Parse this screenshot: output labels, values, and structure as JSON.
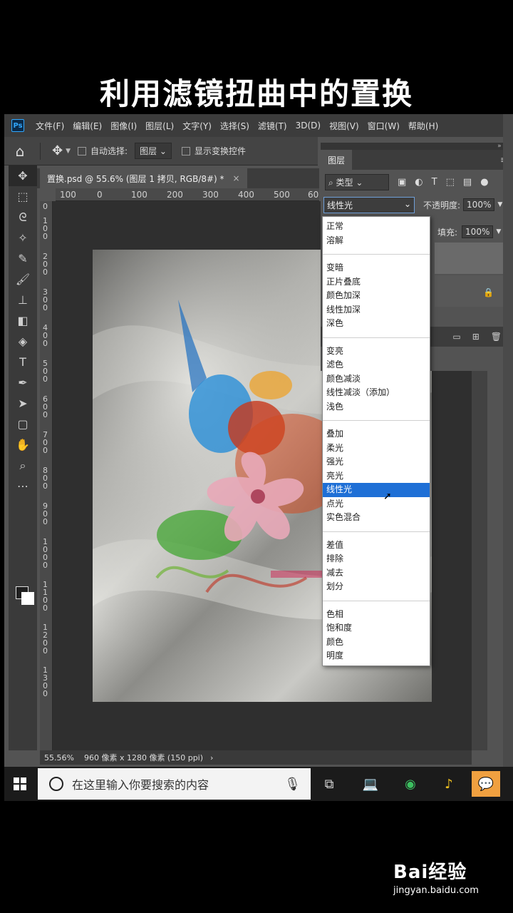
{
  "video_title": "利用滤镜扭曲中的置换",
  "app": {
    "logo": "Ps",
    "menu": [
      "文件(F)",
      "编辑(E)",
      "图像(I)",
      "图层(L)",
      "文字(Y)",
      "选择(S)",
      "滤镜(T)",
      "3D(D)",
      "视图(V)",
      "窗口(W)",
      "帮助(H)"
    ]
  },
  "options_bar": {
    "auto_select_label": "自动选择:",
    "auto_select_value": "图层",
    "show_transform_label": "显示变换控件"
  },
  "document": {
    "tab_title": "置换.psd @ 55.6% (图层 1 拷贝, RGB/8#) *",
    "ruler_h": [
      "100",
      "0",
      "100",
      "200",
      "300",
      "400",
      "500",
      "60"
    ],
    "ruler_v": [
      "0",
      "100",
      "200",
      "300",
      "400",
      "500",
      "600",
      "700",
      "800",
      "900",
      "1000",
      "1100",
      "1200",
      "1300"
    ]
  },
  "status": {
    "zoom": "55.56%",
    "info": "960 像素 x 1280 像素 (150 ppi)"
  },
  "layers_panel": {
    "tab": "图层",
    "kind_filter": "类型",
    "blend_mode": "线性光",
    "opacity_label": "不透明度:",
    "opacity_value": "100%",
    "fill_label": "填充:",
    "fill_value": "100%"
  },
  "blend_modes": {
    "groups": [
      [
        "正常",
        "溶解"
      ],
      [
        "变暗",
        "正片叠底",
        "颜色加深",
        "线性加深",
        "深色"
      ],
      [
        "变亮",
        "滤色",
        "颜色减淡",
        "线性减淡（添加）",
        "浅色"
      ],
      [
        "叠加",
        "柔光",
        "强光",
        "亮光",
        "线性光",
        "点光",
        "实色混合"
      ],
      [
        "差值",
        "排除",
        "减去",
        "划分"
      ],
      [
        "色相",
        "饱和度",
        "颜色",
        "明度"
      ]
    ],
    "selected": "线性光"
  },
  "taskbar": {
    "search_placeholder": "在这里输入你要搜索的内容"
  },
  "watermark": {
    "logo": "Bai经验",
    "url": "jingyan.baidu.com"
  }
}
